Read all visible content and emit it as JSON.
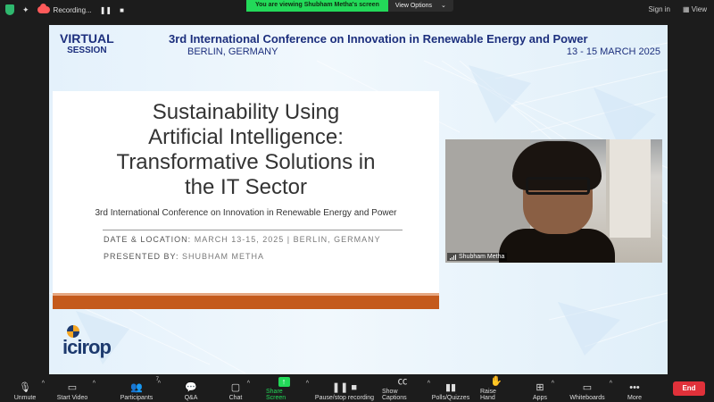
{
  "top_bar": {
    "recording_label": "Recording...",
    "viewing_banner": "You are viewing Shubham Metha's screen",
    "view_options": "View Options",
    "sign_in": "Sign in",
    "view": "View"
  },
  "slide": {
    "virtual_line1": "VIRTUAL",
    "virtual_line2": "SESSION",
    "conference_title": "3rd International Conference on Innovation in Renewable Energy and Power",
    "location": "BERLIN, GERMANY",
    "dates": "13 - 15 MARCH 2025",
    "main_title_lines": [
      "Sustainability Using",
      "Artificial Intelligence:",
      "Transformative Solutions in",
      "the IT Sector"
    ],
    "subtitle": "3rd International Conference on Innovation in Renewable Energy and Power",
    "date_location_label": "DATE & LOCATION:",
    "date_location_value": "MARCH 13-15, 2025 | BERLIN, GERMANY",
    "presented_by_label": "PRESENTED BY:",
    "presented_by_value": "SHUBHAM METHA",
    "logo_text": "icirop"
  },
  "video": {
    "participant_name": "Shubham Metha"
  },
  "toolbar": {
    "unmute": "Unmute",
    "start_video": "Start Video",
    "participants": "Participants",
    "participants_count": "7",
    "qa": "Q&A",
    "chat": "Chat",
    "share_screen": "Share Screen",
    "pause_stop_recording": "Pause/stop recording",
    "show_captions": "Show Captions",
    "polls_quizzes": "Polls/Quizzes",
    "raise_hand": "Raise Hand",
    "apps": "Apps",
    "whiteboards": "Whiteboards",
    "more": "More",
    "end": "End"
  },
  "colors": {
    "accent_green": "#23d959",
    "end_red": "#e0313a",
    "slide_navy": "#1c2f7d",
    "orange_bar": "#c45a1c"
  }
}
